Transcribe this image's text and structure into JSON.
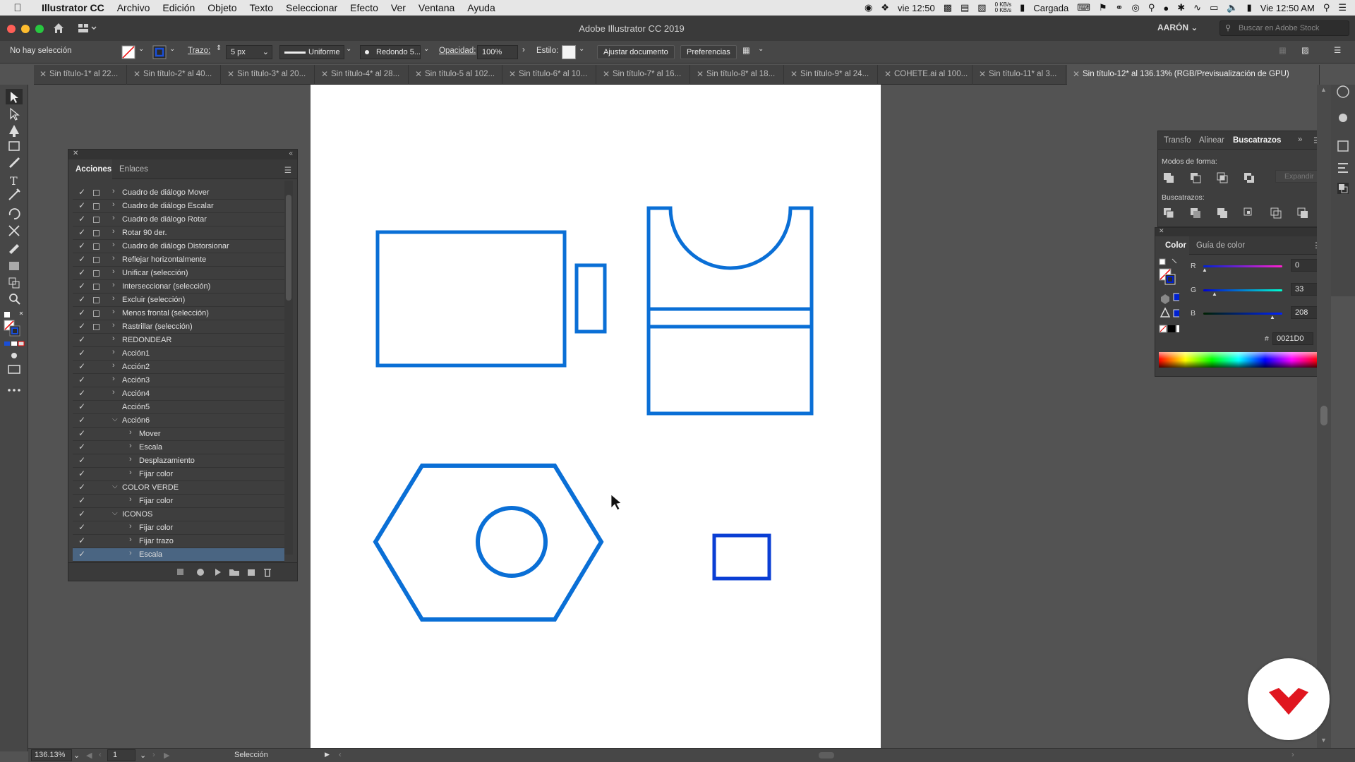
{
  "menubar": {
    "app_name": "Illustrator CC",
    "items": [
      "Archivo",
      "Edición",
      "Objeto",
      "Texto",
      "Seleccionar",
      "Efecto",
      "Ver",
      "Ventana",
      "Ayuda"
    ],
    "status": {
      "day_time_short": "vie 12:50",
      "net_up": "0 KB/s",
      "net_down": "0 KB/s",
      "battery_label": "Cargada",
      "clock": "Vie 12:50 AM"
    }
  },
  "window": {
    "title": "Adobe Illustrator CC 2019",
    "user": "AARÓN",
    "stock_search_placeholder": "Buscar en Adobe Stock"
  },
  "controlbar": {
    "selection_status": "No hay selección",
    "stroke_label": "Trazo:",
    "stroke_value": "5 px",
    "profile": "Uniforme",
    "brush": "Redondo 5...",
    "opacity_label": "Opacidad:",
    "opacity_value": "100%",
    "style_label": "Estilo:",
    "fit_document": "Ajustar documento",
    "preferences": "Preferencias"
  },
  "tabs": [
    {
      "label": "Sin título-1* al 22...",
      "active": false
    },
    {
      "label": "Sin título-2* al 40...",
      "active": false
    },
    {
      "label": "Sin título-3* al 20...",
      "active": false
    },
    {
      "label": "Sin título-4* al 28...",
      "active": false
    },
    {
      "label": "Sin título-5 al 102...",
      "active": false
    },
    {
      "label": "Sin título-6* al 10...",
      "active": false
    },
    {
      "label": "Sin título-7* al 16...",
      "active": false
    },
    {
      "label": "Sin título-8* al 18...",
      "active": false
    },
    {
      "label": "Sin título-9* al 24...",
      "active": false
    },
    {
      "label": "COHETE.ai al 100...",
      "active": false
    },
    {
      "label": "Sin título-11* al 3...",
      "active": false
    },
    {
      "label": "Sin título-12* al 136.13% (RGB/Previsualización de GPU)",
      "active": true
    }
  ],
  "actions_panel": {
    "tab_actions": "Acciones",
    "tab_links": "Enlaces",
    "rows": [
      {
        "label": "Cuadro de diálogo Mover",
        "level": 1,
        "box": true,
        "expand": "right"
      },
      {
        "label": "Cuadro de diálogo Escalar",
        "level": 1,
        "box": true,
        "expand": "right"
      },
      {
        "label": "Cuadro de diálogo Rotar",
        "level": 1,
        "box": true,
        "expand": "right"
      },
      {
        "label": "Rotar 90 der.",
        "level": 1,
        "box": true,
        "expand": "right"
      },
      {
        "label": "Cuadro de diálogo Distorsionar",
        "level": 1,
        "box": true,
        "expand": "right"
      },
      {
        "label": "Reflejar horizontalmente",
        "level": 1,
        "box": true,
        "expand": "right"
      },
      {
        "label": "Unificar (selección)",
        "level": 1,
        "box": true,
        "expand": "right"
      },
      {
        "label": "Interseccionar (selección)",
        "level": 1,
        "box": true,
        "expand": "right"
      },
      {
        "label": "Excluir (selección)",
        "level": 1,
        "box": true,
        "expand": "right"
      },
      {
        "label": "Menos frontal (selección)",
        "level": 1,
        "box": true,
        "expand": "right"
      },
      {
        "label": "Rastrillar (selección)",
        "level": 1,
        "box": true,
        "expand": "right"
      },
      {
        "label": "REDONDEAR",
        "level": 1,
        "box": false,
        "expand": "right"
      },
      {
        "label": "Acción1",
        "level": 1,
        "box": false,
        "expand": "right"
      },
      {
        "label": "Acción2",
        "level": 1,
        "box": false,
        "expand": "right"
      },
      {
        "label": "Acción3",
        "level": 1,
        "box": false,
        "expand": "right"
      },
      {
        "label": "Acción4",
        "level": 1,
        "box": false,
        "expand": "right"
      },
      {
        "label": "Acción5",
        "level": 1,
        "box": false,
        "expand": "none"
      },
      {
        "label": "Acción6",
        "level": 1,
        "box": false,
        "expand": "down"
      },
      {
        "label": "Mover",
        "level": 2,
        "box": false,
        "expand": "right"
      },
      {
        "label": "Escala",
        "level": 2,
        "box": false,
        "expand": "right"
      },
      {
        "label": "Desplazamiento",
        "level": 2,
        "box": false,
        "expand": "right"
      },
      {
        "label": "Fijar color",
        "level": 2,
        "box": false,
        "expand": "right"
      },
      {
        "label": "COLOR VERDE",
        "level": 1,
        "box": false,
        "expand": "down"
      },
      {
        "label": "Fijar color",
        "level": 2,
        "box": false,
        "expand": "right"
      },
      {
        "label": "ICONOS",
        "level": 1,
        "box": false,
        "expand": "down"
      },
      {
        "label": "Fijar color",
        "level": 2,
        "box": false,
        "expand": "right"
      },
      {
        "label": "Fijar trazo",
        "level": 2,
        "box": false,
        "expand": "right"
      },
      {
        "label": "Escala",
        "level": 2,
        "box": false,
        "expand": "right",
        "selected": true
      }
    ]
  },
  "pathfinder_panel": {
    "tabs": [
      "Transfo",
      "Alinear",
      "Buscatrazos"
    ],
    "active_tab": "Buscatrazos",
    "shape_modes_label": "Modos de forma:",
    "expand_button": "Expandir",
    "pathfinders_label": "Buscatrazos:"
  },
  "color_panel": {
    "tabs": [
      "Color",
      "Guía de color"
    ],
    "active_tab": "Color",
    "r_label": "R",
    "r_value": "0",
    "g_label": "G",
    "g_value": "33",
    "b_label": "B",
    "b_value": "208",
    "hash": "#",
    "hex_value": "0021D0"
  },
  "status_bar": {
    "zoom": "136.13%",
    "artboard_index": "1",
    "tool_name": "Selección"
  },
  "colors": {
    "art_stroke_blue": "#0a6fd6",
    "art_stroke_dark_blue": "#0a3ed4",
    "selected_color": "#0021d0",
    "accent_logo": "#e0161f"
  }
}
